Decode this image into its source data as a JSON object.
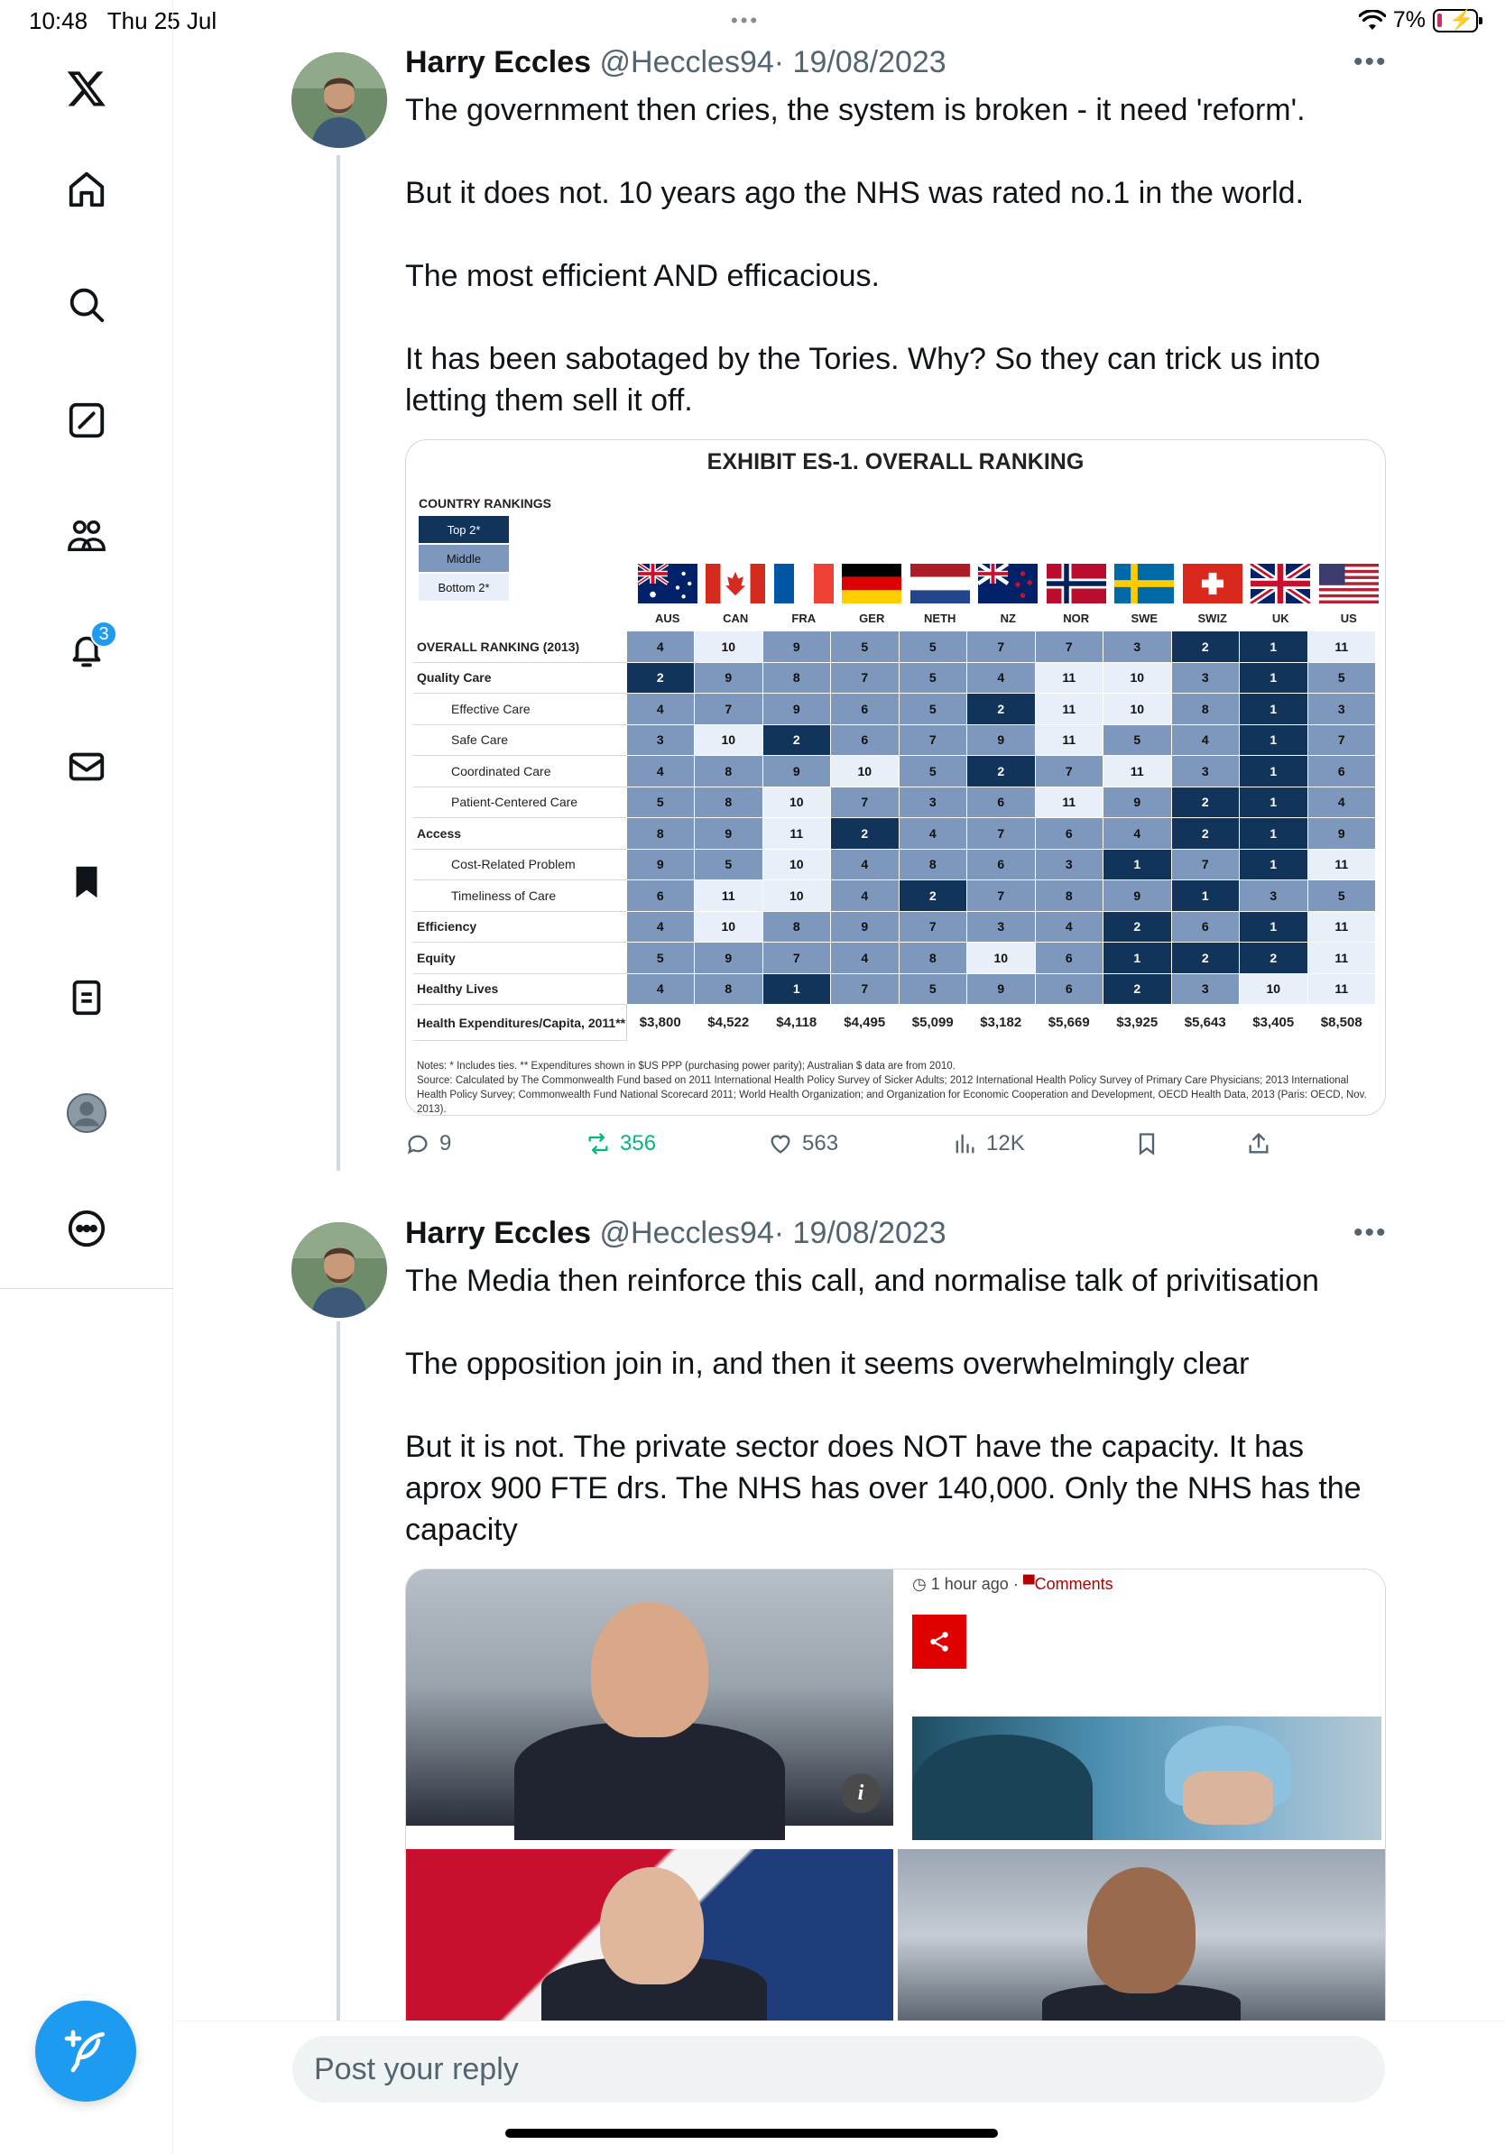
{
  "status_bar": {
    "time": "10:48",
    "date": "Thu 25 Jul",
    "battery": "7%"
  },
  "sidebar": {
    "items": [
      {
        "name": "x-logo"
      },
      {
        "name": "home"
      },
      {
        "name": "explore"
      },
      {
        "name": "grok"
      },
      {
        "name": "communities"
      },
      {
        "name": "notifications",
        "badge": "3"
      },
      {
        "name": "messages"
      },
      {
        "name": "bookmarks"
      },
      {
        "name": "lists"
      },
      {
        "name": "profile"
      },
      {
        "name": "more"
      }
    ],
    "compose_icon": "feather-plus-icon"
  },
  "tweets": [
    {
      "name": "Harry Eccles",
      "handle": "@Heccles94",
      "date": "· 19/08/2023",
      "paragraphs": [
        "The government then cries, the system is broken - it need 'reform'.",
        "But it does not. 10 years ago the NHS was rated no.1 in the world.",
        "The most efficient AND efficacious.",
        "It has been sabotaged by the Tories. Why? So they can trick us into letting them sell it off."
      ],
      "actions": {
        "replies": "9",
        "retweets": "356",
        "likes": "563",
        "views": "12K"
      }
    },
    {
      "name": "Harry Eccles",
      "handle": "@Heccles94",
      "date": "· 19/08/2023",
      "paragraphs": [
        "The Media then reinforce this call, and normalise talk of privitisation",
        "The opposition join in, and then it seems overwhelmingly clear",
        "But it is not. The private sector does NOT have the capacity. It has aprox 900 FTE drs. The NHS has over 140,000. Only the NHS has the capacity"
      ],
      "media": {
        "time_ago": "1 hour ago",
        "separator": "·",
        "comments_label": "Comments"
      }
    }
  ],
  "chart_data": {
    "type": "table",
    "title": "EXHIBIT ES-1. OVERALL RANKING",
    "legend_title": "COUNTRY RANKINGS",
    "legend": [
      "Top 2*",
      "Middle",
      "Bottom 2*"
    ],
    "colors": {
      "top": "#12335a",
      "middle": "#7e98bd",
      "bottom": "#e9eff8"
    },
    "columns": [
      "AUS",
      "CAN",
      "FRA",
      "GER",
      "NETH",
      "NZ",
      "NOR",
      "SWE",
      "SWIZ",
      "UK",
      "US"
    ],
    "rows": [
      {
        "label": "OVERALL RANKING (2013)",
        "style": "bold",
        "values": [
          "4",
          "10",
          "9",
          "5",
          "5",
          "7",
          "7",
          "3",
          "2",
          "1",
          "11"
        ]
      },
      {
        "label": "Quality Care",
        "style": "bold",
        "values": [
          "2",
          "9",
          "8",
          "7",
          "5",
          "4",
          "11",
          "10",
          "3",
          "1",
          "5"
        ]
      },
      {
        "label": "Effective Care",
        "style": "sub",
        "values": [
          "4",
          "7",
          "9",
          "6",
          "5",
          "2",
          "11",
          "10",
          "8",
          "1",
          "3"
        ]
      },
      {
        "label": "Safe Care",
        "style": "sub",
        "values": [
          "3",
          "10",
          "2",
          "6",
          "7",
          "9",
          "11",
          "5",
          "4",
          "1",
          "7"
        ]
      },
      {
        "label": "Coordinated Care",
        "style": "sub",
        "values": [
          "4",
          "8",
          "9",
          "10",
          "5",
          "2",
          "7",
          "11",
          "3",
          "1",
          "6"
        ]
      },
      {
        "label": "Patient-Centered Care",
        "style": "sub",
        "values": [
          "5",
          "8",
          "10",
          "7",
          "3",
          "6",
          "11",
          "9",
          "2",
          "1",
          "4"
        ]
      },
      {
        "label": "Access",
        "style": "bold",
        "values": [
          "8",
          "9",
          "11",
          "2",
          "4",
          "7",
          "6",
          "4",
          "2",
          "1",
          "9"
        ]
      },
      {
        "label": "Cost-Related Problem",
        "style": "sub",
        "values": [
          "9",
          "5",
          "10",
          "4",
          "8",
          "6",
          "3",
          "1",
          "7",
          "1",
          "11"
        ]
      },
      {
        "label": "Timeliness of Care",
        "style": "sub",
        "values": [
          "6",
          "11",
          "10",
          "4",
          "2",
          "7",
          "8",
          "9",
          "1",
          "3",
          "5"
        ]
      },
      {
        "label": "Efficiency",
        "style": "bold",
        "values": [
          "4",
          "10",
          "8",
          "9",
          "7",
          "3",
          "4",
          "2",
          "6",
          "1",
          "11"
        ]
      },
      {
        "label": "Equity",
        "style": "bold",
        "values": [
          "5",
          "9",
          "7",
          "4",
          "8",
          "10",
          "6",
          "1",
          "2",
          "2",
          "11"
        ]
      },
      {
        "label": "Healthy Lives",
        "style": "bold",
        "values": [
          "4",
          "8",
          "1",
          "7",
          "5",
          "9",
          "6",
          "2",
          "3",
          "10",
          "11"
        ]
      }
    ],
    "expenditure": {
      "label": "Health Expenditures/Capita, 2011**",
      "values": [
        "$3,800",
        "$4,522",
        "$4,118",
        "$4,495",
        "$5,099",
        "$3,182",
        "$5,669",
        "$3,925",
        "$5,643",
        "$3,405",
        "$8,508"
      ]
    },
    "notes": [
      "Notes: * Includes ties. ** Expenditures shown in $US PPP (purchasing power parity); Australian $ data are from 2010.",
      "Source: Calculated by The Commonwealth Fund based on 2011 International Health Policy Survey of Sicker Adults; 2012 International Health Policy Survey of Primary Care Physicians; 2013 International Health Policy Survey; Commonwealth Fund National Scorecard 2011; World Health Organization; and Organization for Economic Cooperation and Development, OECD Health Data, 2013 (Paris: OECD, Nov. 2013)."
    ]
  },
  "reply": {
    "placeholder": "Post your reply"
  }
}
